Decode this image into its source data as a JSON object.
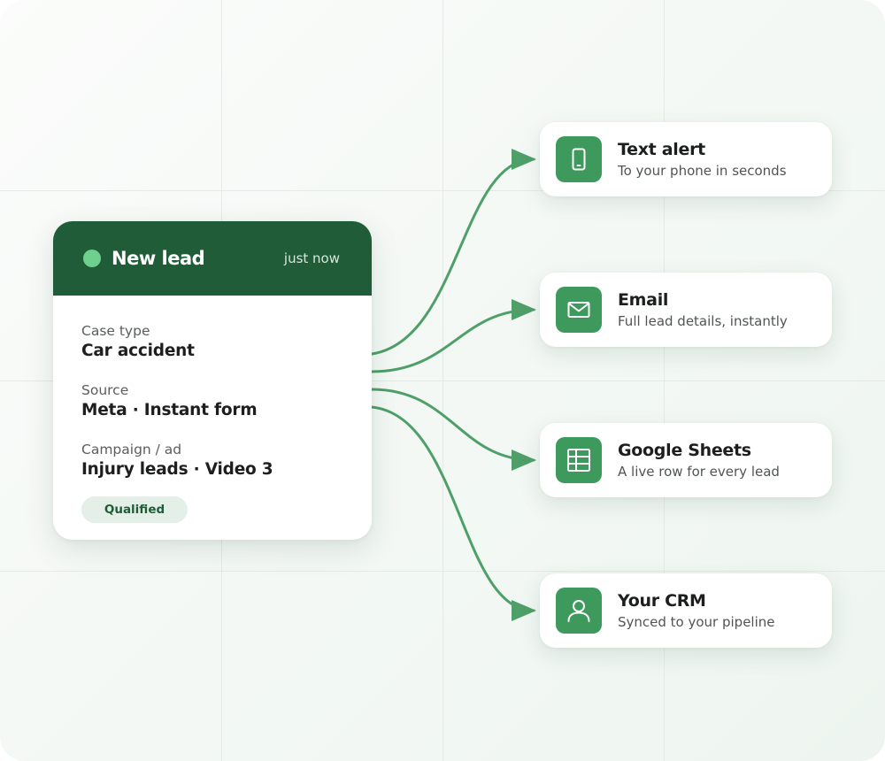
{
  "lead": {
    "title": "New lead",
    "time": "just now",
    "status_dot_color": "#6fcf8f",
    "header_color": "#1f5c37",
    "fields": [
      {
        "label": "Case type",
        "value": "Car accident"
      },
      {
        "label": "Source",
        "value": "Meta · Instant form"
      },
      {
        "label": "Campaign / ad",
        "value": "Injury leads · Video 3"
      }
    ],
    "badge": "Qualified"
  },
  "destinations": [
    {
      "title": "Text alert",
      "subtitle": "To your phone in seconds",
      "icon": "phone-icon"
    },
    {
      "title": "Email",
      "subtitle": "Full lead details, instantly",
      "icon": "mail-icon"
    },
    {
      "title": "Google Sheets",
      "subtitle": "A live row for every lead",
      "icon": "spreadsheet-icon"
    },
    {
      "title": "Your CRM",
      "subtitle": "Synced to your pipeline",
      "icon": "user-icon"
    }
  ],
  "colors": {
    "accent": "#3d9a5c",
    "connector": "#4f9f68",
    "badge_bg": "#e3efe7"
  }
}
